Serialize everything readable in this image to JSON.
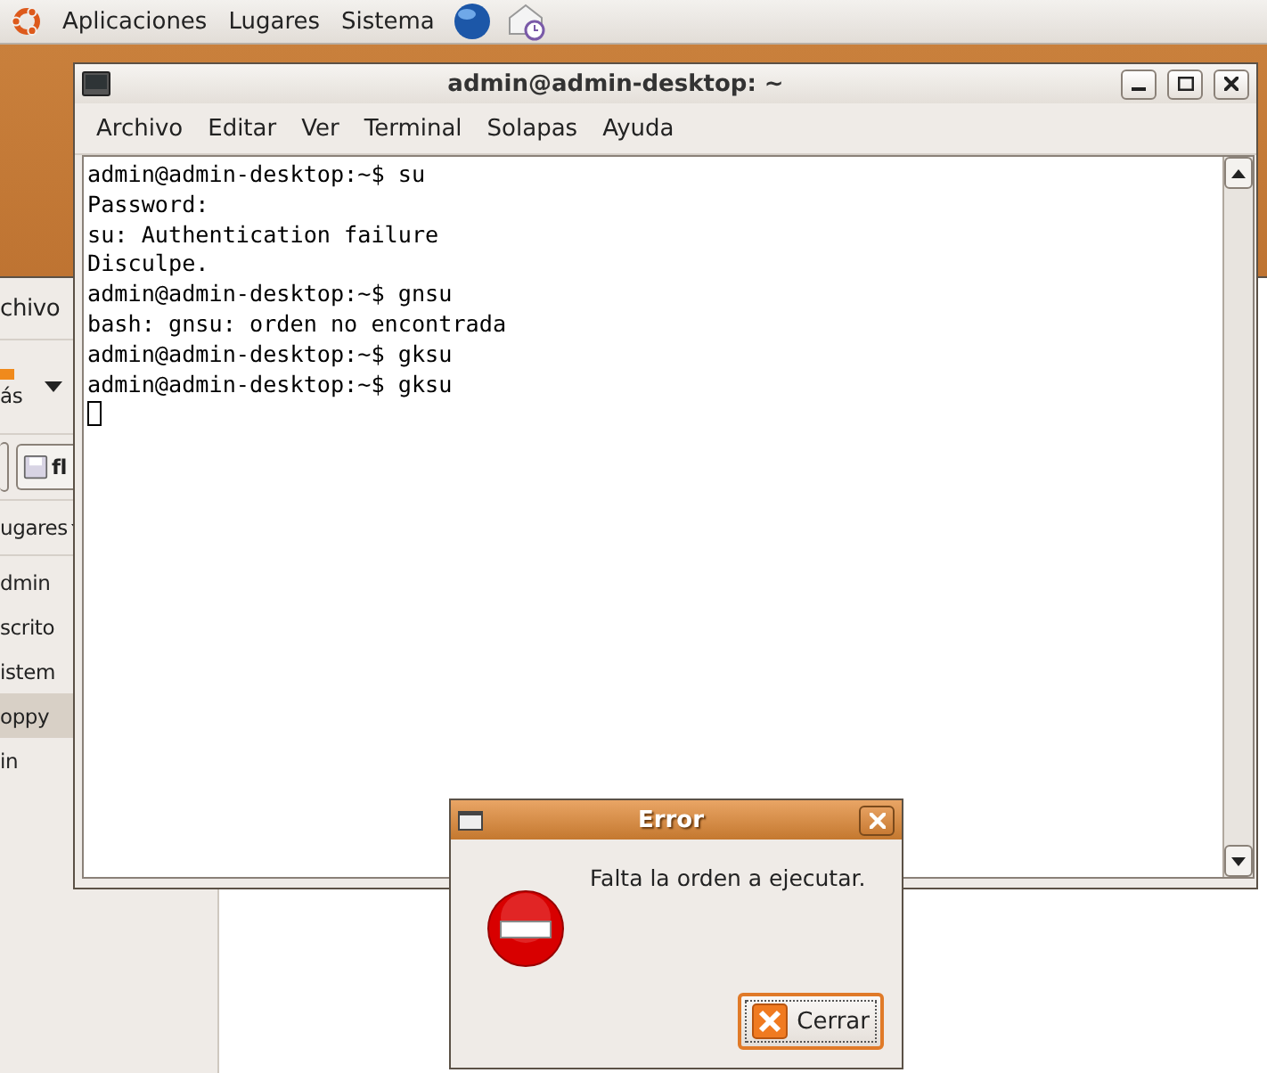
{
  "top_panel": {
    "menus": [
      "Aplicaciones",
      "Lugares",
      "Sistema"
    ]
  },
  "back_window": {
    "menu": "chivo",
    "toolbar_label": "ás",
    "location": "fl",
    "places_header": "ugares",
    "places": [
      {
        "label": "dmin",
        "selected": false
      },
      {
        "label": "scrito",
        "selected": false
      },
      {
        "label": "istem",
        "selected": false
      },
      {
        "label": "oppy",
        "selected": true
      },
      {
        "label": "in",
        "selected": false
      }
    ]
  },
  "terminal": {
    "title": "admin@admin-desktop: ~",
    "menus": [
      "Archivo",
      "Editar",
      "Ver",
      "Terminal",
      "Solapas",
      "Ayuda"
    ],
    "lines": [
      "admin@admin-desktop:~$ su",
      "Password:",
      "su: Authentication failure",
      "Disculpe.",
      "admin@admin-desktop:~$ gnsu",
      "bash: gnsu: orden no encontrada",
      "admin@admin-desktop:~$ gksu",
      "admin@admin-desktop:~$ gksu"
    ]
  },
  "dialog": {
    "title": "Error",
    "message": "Falta la orden a ejecutar.",
    "button": "Cerrar"
  }
}
